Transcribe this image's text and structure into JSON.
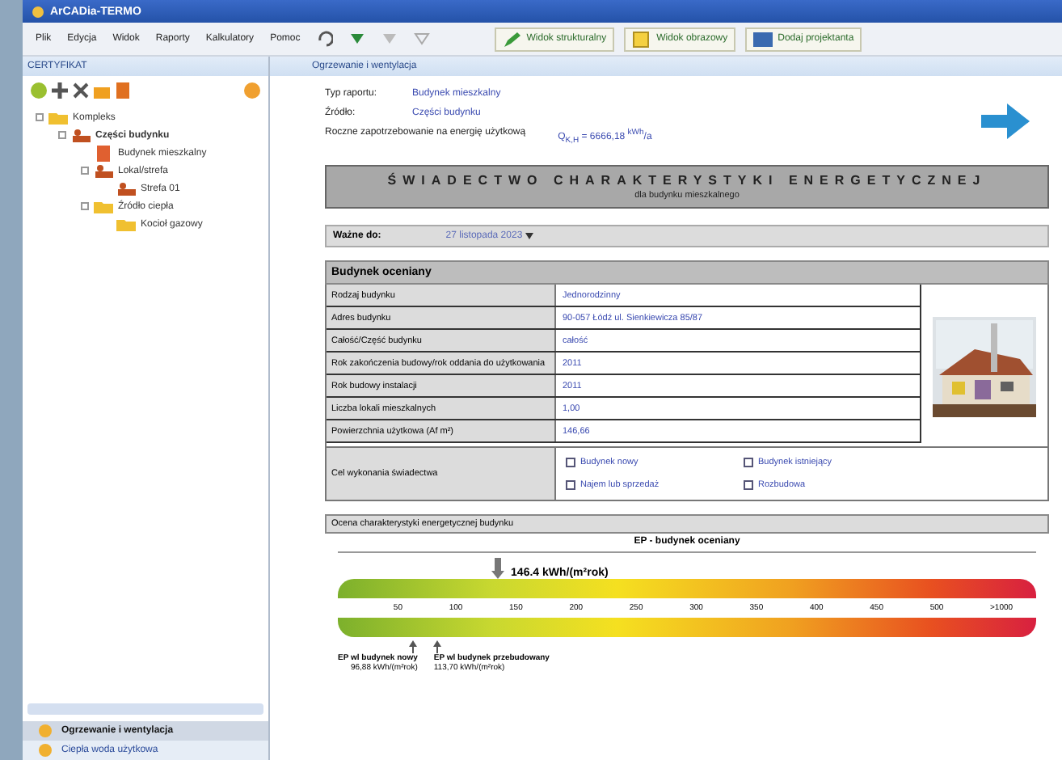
{
  "window": {
    "title": "ArCADia-TERMO"
  },
  "menu": [
    "Plik",
    "Edycja",
    "Widok",
    "Raporty",
    "Kalkulatory",
    "Pomoc"
  ],
  "toolbar_buttons": [
    {
      "label": "Widok strukturalny",
      "kind": "pencil"
    },
    {
      "label": "Widok obrazowy",
      "kind": "note"
    },
    {
      "label": "Dodaj projektanta",
      "kind": "card"
    }
  ],
  "sidebar": {
    "title": "CERTYFIKAT",
    "tree": [
      {
        "label": "Kompleks",
        "bold": false,
        "kind": "folder",
        "children": [
          {
            "label": "Części budynku",
            "bold": true,
            "kind": "people",
            "children": [
              {
                "label": "Budynek mieszkalny",
                "bold": false,
                "kind": "doc"
              },
              {
                "label": "Lokal/strefa",
                "bold": false,
                "kind": "people",
                "children": [
                  {
                    "label": "Strefa 01",
                    "bold": false,
                    "kind": "people"
                  }
                ]
              },
              {
                "label": "Źródło ciepła",
                "bold": false,
                "kind": "folder",
                "children": [
                  {
                    "label": "Kocioł gazowy",
                    "bold": false,
                    "kind": "folder"
                  }
                ]
              }
            ]
          }
        ]
      }
    ],
    "nav": [
      {
        "label": "Ogrzewanie i wentylacja",
        "selected": true
      },
      {
        "label": "Ciepła woda użytkowa",
        "selected": false
      }
    ]
  },
  "content": {
    "title": "Ogrzewanie i wentylacja",
    "fields": [
      {
        "label": "Typ raportu:",
        "value": "Budynek mieszkalny"
      },
      {
        "label": "Źródło:",
        "value": "Części budynku"
      }
    ],
    "demand": {
      "label": "Roczne zapotrzebowanie na energię użytkową",
      "symbol": "Q$_{K,H}$ = 6666,18 $^{kWh}$/a"
    },
    "certificate": {
      "title": "ŚWIADECTWO CHARAKTERYSTYKI ENERGETYCZNEJ",
      "subtitle": "dla budynku mieszkalnego"
    },
    "valid_until": {
      "label": "Ważne do:",
      "value": "27 listopada 2023"
    },
    "building": {
      "title": "Budynek oceniany",
      "rows": [
        {
          "label": "Rodzaj budynku",
          "value": "Jednorodzinny"
        },
        {
          "label": "Adres budynku",
          "value": "90-057 Łódź ul. Sienkiewicza 85/87"
        },
        {
          "label": "Całość/Część budynku",
          "value": "całość"
        },
        {
          "label": "Rok zakończenia budowy/rok oddania do użytkowania",
          "value": "2011"
        },
        {
          "label": "Rok budowy instalacji",
          "value": "2011"
        },
        {
          "label": "Liczba lokali mieszkalnych",
          "value": "1,00"
        },
        {
          "label": "Powierzchnia użytkowa (Af m²)",
          "value": "146,66"
        }
      ],
      "purpose": {
        "label": "Cel wykonania świadectwa",
        "options": [
          {
            "label": "Budynek nowy",
            "checked": false
          },
          {
            "label": "Budynek istniejący",
            "checked": false
          },
          {
            "label": "Najem lub sprzedaż",
            "checked": false
          },
          {
            "label": "Rozbudowa",
            "checked": false
          }
        ]
      }
    },
    "scale": {
      "title": "Ocena charakterystyki energetycznej budynku",
      "heading": "EP - budynek oceniany",
      "reading": "146.4 kWh/(m²rok)",
      "level": 0.22,
      "ticks": [
        "50",
        "100",
        "150",
        "200",
        "250",
        "300",
        "350",
        "400",
        "450",
        "500",
        ">1000"
      ],
      "refs": [
        {
          "label": "EP wl budynek nowy",
          "value": "96,88 kWh/(m²rok)"
        },
        {
          "label": "EP wl budynek przebudowany",
          "value": "113,70 kWh/(m²rok)"
        }
      ]
    }
  }
}
